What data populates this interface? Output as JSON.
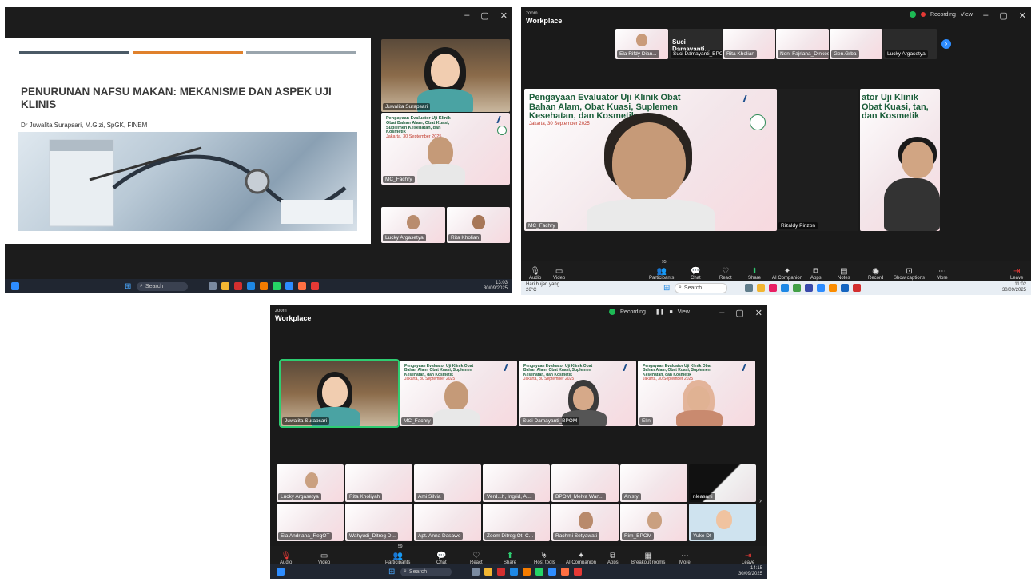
{
  "s1": {
    "slide": {
      "title": "PENURUNAN NAFSU MAKAN: MEKANISME DAN ASPEK UJI KLINIS",
      "author": "Dr Juwalita Surapsari, M.Gizi, SpGK, FINEM",
      "bar_colors": [
        "#4b5a66",
        "#e0812c",
        "#9aa5ad"
      ]
    },
    "tiles": {
      "speaker": "Juwalita Surapsari",
      "mc": "MC_Fachry",
      "small1": "Lucky Argasetya",
      "small2": "Rita Kholian"
    },
    "banner": {
      "title": "Pengayaan Evaluator Uji Klinik Obat Bahan Alam, Obat Kuasi, Suplemen Kesehatan, dan Kosmetik",
      "date": "Jakarta, 30 September 2025"
    },
    "taskbar": {
      "search": "Search",
      "time": "13:03",
      "date": "30/09/2025"
    }
  },
  "s2": {
    "zoom": "zoom",
    "workplace": "Workplace",
    "recording": "Recording",
    "view": "View",
    "strip": {
      "speaker_name": "Suci Damayanti...",
      "names": [
        "Ela Rifdy Dian...",
        "Suci Damayanti_BPOM",
        "Rita Kholian",
        "Neni Fajriana_Dinkes",
        "Gen.Grba",
        "Lucky Argasetya"
      ]
    },
    "banner": {
      "title": "Pengayaan Evaluator Uji Klinik Obat Bahan Alam, Obat Kuasi, Suplemen Kesehatan, dan Kosmetik",
      "date": "Jakarta, 30 September 2025",
      "right_title": "ator Uji Klinik Obat Kuasi, tan, dan Kosmetik"
    },
    "main_name": "MC_Fachry",
    "right_name": "Rizaldy Pinzon",
    "toolbar": [
      "Audio",
      "Video",
      "Participants",
      "Chat",
      "React",
      "Share",
      "AI Companion",
      "Apps",
      "Notes",
      "Record",
      "Show captions",
      "More",
      "Leave"
    ],
    "participants_count": "95",
    "taskbar": {
      "weather": "Hari hujan yang...",
      "temp": "26°C",
      "search": "Search",
      "time": "11:02",
      "date": "30/09/2025"
    }
  },
  "s3": {
    "zoom": "zoom",
    "workplace": "Workplace",
    "recording": "Recording...",
    "view": "View",
    "top_row": [
      "Juwalita Surapsari",
      "MC_Fachry",
      "Suci Damayanti_BPOM",
      "Elin"
    ],
    "grid": [
      "Lucky Argasetya",
      "Rita Kholiyah",
      "Ami Silvia",
      "Verd...h, Ingrid, Al...",
      "BPOM_Melva Wan...",
      "Anisty",
      "nleasarti",
      "Ela Andriana_RegOT",
      "Wahyudi_Ditreg D...",
      "Apt. Anna Dasawe",
      "Zoom Ditreg Ot. C...",
      "Rachmi Setyawati",
      "Rim_BPOM",
      "Yuke Dt"
    ],
    "banner": {
      "title": "Pengayaan Evaluator Uji Klinik Obat Bahan Alam, Obat Kuasi, Suplemen Kesehatan, dan Kosmetik",
      "date": "Jakarta, 30 September 2025"
    },
    "participants_count": "59",
    "toolbar": [
      "Audio",
      "Video",
      "Participants",
      "Chat",
      "React",
      "Share",
      "Host tools",
      "AI Companion",
      "Apps",
      "Breakout rooms",
      "More",
      "Leave"
    ],
    "taskbar": {
      "search": "Search",
      "time": "14:15",
      "date": "30/09/2025"
    }
  },
  "colors": {
    "zoom_blue": "#2d8cff",
    "speaker_green": "#2ecc71",
    "leave_red": "#e53935"
  }
}
